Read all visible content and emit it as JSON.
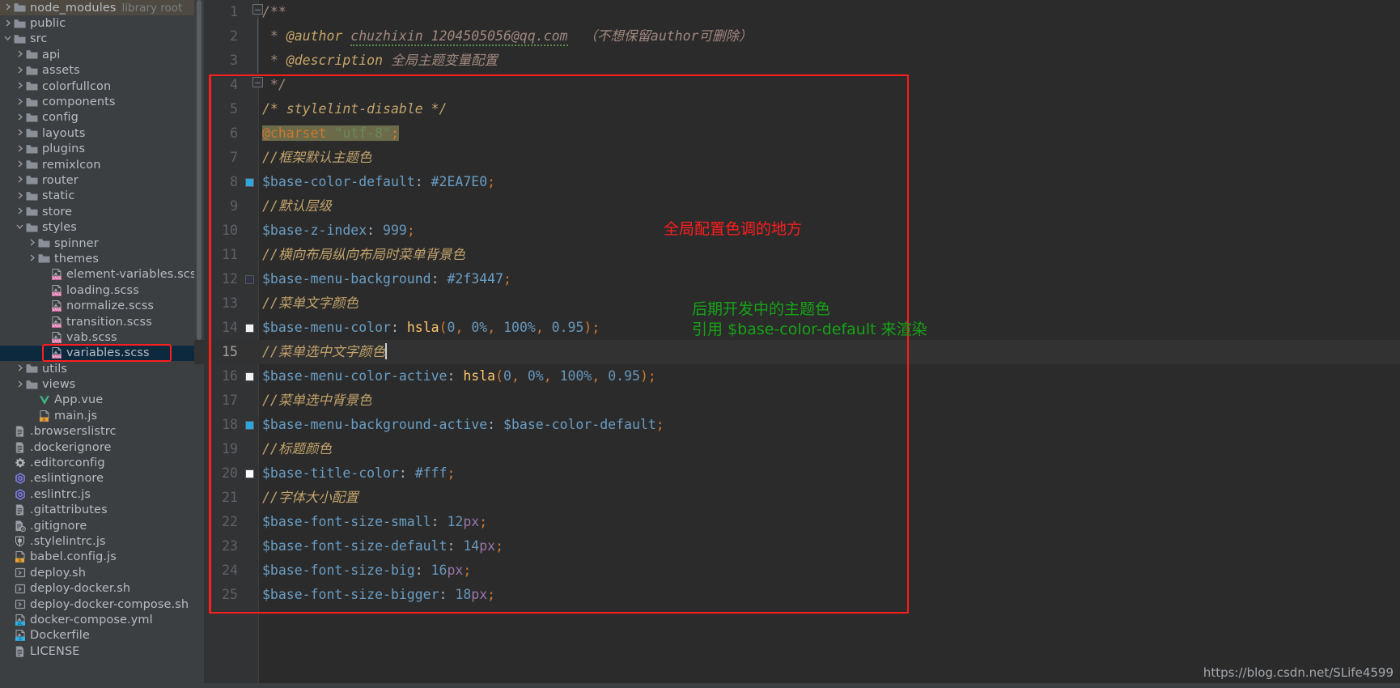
{
  "sidebar": {
    "name": "project-tree",
    "items": [
      {
        "label": "node_modules",
        "suffix": "library root",
        "icon": "folder-icon",
        "arrow": "chevron-right",
        "indent": 1,
        "state": "library-root"
      },
      {
        "label": "public",
        "suffix": "",
        "icon": "folder-icon",
        "arrow": "chevron-right",
        "indent": 1,
        "state": ""
      },
      {
        "label": "src",
        "suffix": "",
        "icon": "folder-icon",
        "arrow": "chevron-down",
        "indent": 1,
        "state": ""
      },
      {
        "label": "api",
        "suffix": "",
        "icon": "folder-icon",
        "arrow": "chevron-right",
        "indent": 2,
        "state": ""
      },
      {
        "label": "assets",
        "suffix": "",
        "icon": "folder-icon",
        "arrow": "chevron-right",
        "indent": 2,
        "state": ""
      },
      {
        "label": "colorfullcon",
        "suffix": "",
        "icon": "folder-icon",
        "arrow": "chevron-right",
        "indent": 2,
        "state": ""
      },
      {
        "label": "components",
        "suffix": "",
        "icon": "folder-icon",
        "arrow": "chevron-right",
        "indent": 2,
        "state": ""
      },
      {
        "label": "config",
        "suffix": "",
        "icon": "folder-icon",
        "arrow": "chevron-right",
        "indent": 2,
        "state": ""
      },
      {
        "label": "layouts",
        "suffix": "",
        "icon": "folder-icon",
        "arrow": "chevron-right",
        "indent": 2,
        "state": ""
      },
      {
        "label": "plugins",
        "suffix": "",
        "icon": "folder-icon",
        "arrow": "chevron-right",
        "indent": 2,
        "state": ""
      },
      {
        "label": "remixIcon",
        "suffix": "",
        "icon": "folder-icon",
        "arrow": "chevron-right",
        "indent": 2,
        "state": ""
      },
      {
        "label": "router",
        "suffix": "",
        "icon": "folder-icon",
        "arrow": "chevron-right",
        "indent": 2,
        "state": ""
      },
      {
        "label": "static",
        "suffix": "",
        "icon": "folder-icon",
        "arrow": "chevron-right",
        "indent": 2,
        "state": ""
      },
      {
        "label": "store",
        "suffix": "",
        "icon": "folder-icon",
        "arrow": "chevron-right",
        "indent": 2,
        "state": ""
      },
      {
        "label": "styles",
        "suffix": "",
        "icon": "folder-icon",
        "arrow": "chevron-down",
        "indent": 2,
        "state": ""
      },
      {
        "label": "spinner",
        "suffix": "",
        "icon": "folder-icon",
        "arrow": "chevron-right",
        "indent": 3,
        "state": ""
      },
      {
        "label": "themes",
        "suffix": "",
        "icon": "folder-icon",
        "arrow": "chevron-right",
        "indent": 3,
        "state": ""
      },
      {
        "label": "element-variables.scss",
        "suffix": "",
        "icon": "sass-file-icon",
        "arrow": "",
        "indent": 4,
        "state": ""
      },
      {
        "label": "loading.scss",
        "suffix": "",
        "icon": "sass-file-icon",
        "arrow": "",
        "indent": 4,
        "state": ""
      },
      {
        "label": "normalize.scss",
        "suffix": "",
        "icon": "sass-file-icon",
        "arrow": "",
        "indent": 4,
        "state": ""
      },
      {
        "label": "transition.scss",
        "suffix": "",
        "icon": "sass-file-icon",
        "arrow": "",
        "indent": 4,
        "state": ""
      },
      {
        "label": "vab.scss",
        "suffix": "",
        "icon": "sass-file-icon",
        "arrow": "",
        "indent": 4,
        "state": ""
      },
      {
        "label": "variables.scss",
        "suffix": "",
        "icon": "sass-file-icon",
        "arrow": "",
        "indent": 4,
        "state": "selected"
      },
      {
        "label": "utils",
        "suffix": "",
        "icon": "folder-icon",
        "arrow": "chevron-right",
        "indent": 2,
        "state": ""
      },
      {
        "label": "views",
        "suffix": "",
        "icon": "folder-icon",
        "arrow": "chevron-right",
        "indent": 2,
        "state": ""
      },
      {
        "label": "App.vue",
        "suffix": "",
        "icon": "vue-file-icon",
        "arrow": "",
        "indent": 3,
        "state": ""
      },
      {
        "label": "main.js",
        "suffix": "",
        "icon": "js-file-icon",
        "arrow": "",
        "indent": 3,
        "state": ""
      },
      {
        "label": ".browserslistrc",
        "suffix": "",
        "icon": "text-file-icon",
        "arrow": "",
        "indent": 1,
        "state": ""
      },
      {
        "label": ".dockerignore",
        "suffix": "",
        "icon": "text-file-icon",
        "arrow": "",
        "indent": 1,
        "state": ""
      },
      {
        "label": ".editorconfig",
        "suffix": "",
        "icon": "gear-icon",
        "arrow": "",
        "indent": 1,
        "state": ""
      },
      {
        "label": ".eslintignore",
        "suffix": "",
        "icon": "eslint-icon",
        "arrow": "",
        "indent": 1,
        "state": ""
      },
      {
        "label": ".eslintrc.js",
        "suffix": "",
        "icon": "eslint-icon",
        "arrow": "",
        "indent": 1,
        "state": ""
      },
      {
        "label": ".gitattributes",
        "suffix": "",
        "icon": "text-file-icon",
        "arrow": "",
        "indent": 1,
        "state": ""
      },
      {
        "label": ".gitignore",
        "suffix": "",
        "icon": "gitignore-file-icon",
        "arrow": "",
        "indent": 1,
        "state": ""
      },
      {
        "label": ".stylelintrc.js",
        "suffix": "",
        "icon": "stylelint-icon",
        "arrow": "",
        "indent": 1,
        "state": ""
      },
      {
        "label": "babel.config.js",
        "suffix": "",
        "icon": "js-file-icon",
        "arrow": "",
        "indent": 1,
        "state": ""
      },
      {
        "label": "deploy.sh",
        "suffix": "",
        "icon": "shell-script-icon",
        "arrow": "",
        "indent": 1,
        "state": ""
      },
      {
        "label": "deploy-docker.sh",
        "suffix": "",
        "icon": "shell-script-icon",
        "arrow": "",
        "indent": 1,
        "state": ""
      },
      {
        "label": "deploy-docker-compose.sh",
        "suffix": "",
        "icon": "shell-script-icon",
        "arrow": "",
        "indent": 1,
        "state": ""
      },
      {
        "label": "docker-compose.yml",
        "suffix": "",
        "icon": "docker-compose-icon",
        "arrow": "",
        "indent": 1,
        "state": ""
      },
      {
        "label": "Dockerfile",
        "suffix": "",
        "icon": "dockerfile-icon",
        "arrow": "",
        "indent": 1,
        "state": ""
      },
      {
        "label": "LICENSE",
        "suffix": "",
        "icon": "text-file-icon",
        "arrow": "",
        "indent": 1,
        "state": ""
      }
    ]
  },
  "editor": {
    "name": "scss-code-editor",
    "file": "variables.scss",
    "caret_line": 15,
    "lines": [
      {
        "num": "1",
        "swatch": "",
        "text": "/**"
      },
      {
        "num": "2",
        "swatch": "",
        "text": " * @author chuzhixin 1204505056@qq.com  （不想保留author可删除）"
      },
      {
        "num": "3",
        "swatch": "",
        "text": " * @description 全局主题变量配置"
      },
      {
        "num": "4",
        "swatch": "",
        "text": " */"
      },
      {
        "num": "5",
        "swatch": "",
        "text": "/* stylelint-disable */"
      },
      {
        "num": "6",
        "swatch": "",
        "text": "@charset \"utf-8\";"
      },
      {
        "num": "7",
        "swatch": "",
        "text": "//框架默认主题色"
      },
      {
        "num": "8",
        "swatch": "#2EA7E0",
        "text": "$base-color-default: #2EA7E0;"
      },
      {
        "num": "9",
        "swatch": "",
        "text": "//默认层级"
      },
      {
        "num": "10",
        "swatch": "",
        "text": "$base-z-index: 999;"
      },
      {
        "num": "11",
        "swatch": "",
        "text": "//横向布局纵向布局时菜单背景色"
      },
      {
        "num": "12",
        "swatch": "#2f3447",
        "text": "$base-menu-background: #2f3447;"
      },
      {
        "num": "13",
        "swatch": "",
        "text": "//菜单文字颜色"
      },
      {
        "num": "14",
        "swatch": "#f2f2f2",
        "text": "$base-menu-color: hsla(0, 0%, 100%, 0.95);"
      },
      {
        "num": "15",
        "swatch": "",
        "text": "//菜单选中文字颜色"
      },
      {
        "num": "16",
        "swatch": "#f2f2f2",
        "text": "$base-menu-color-active: hsla(0, 0%, 100%, 0.95);"
      },
      {
        "num": "17",
        "swatch": "",
        "text": "//菜单选中背景色"
      },
      {
        "num": "18",
        "swatch": "#29a8e0",
        "text": "$base-menu-background-active: $base-color-default;"
      },
      {
        "num": "19",
        "swatch": "",
        "text": "//标题颜色"
      },
      {
        "num": "20",
        "swatch": "#ffffff",
        "text": "$base-title-color: #fff;"
      },
      {
        "num": "21",
        "swatch": "",
        "text": "//字体大小配置"
      },
      {
        "num": "22",
        "swatch": "",
        "text": "$base-font-size-small: 12px;"
      },
      {
        "num": "23",
        "swatch": "",
        "text": "$base-font-size-default: 14px;"
      },
      {
        "num": "24",
        "swatch": "",
        "text": "$base-font-size-big: 16px;"
      },
      {
        "num": "25",
        "swatch": "",
        "text": "$base-font-size-bigger: 18px;"
      }
    ]
  },
  "annotations": {
    "red_note": "全局配置色调的地方",
    "green_note_line1": "后期开发中的主题色",
    "green_note_line2": "引用 $base-color-default 来渲染",
    "colors": {
      "red": "#ff1d1d",
      "green": "#16a316"
    }
  },
  "watermark": {
    "text": "https://blog.csdn.net/SLife4599"
  }
}
